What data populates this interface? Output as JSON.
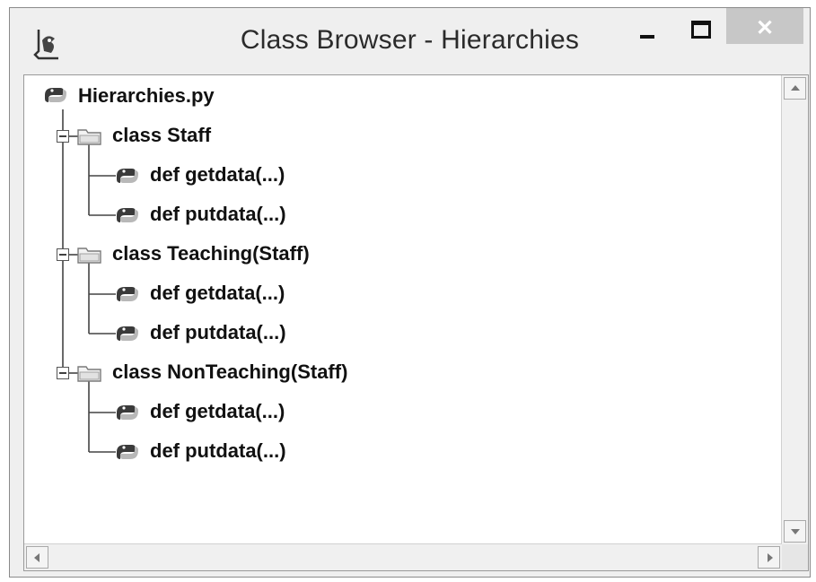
{
  "window": {
    "title": "Class Browser - Hierarchies",
    "close_glyph": "✕"
  },
  "tree": {
    "root": {
      "label": "Hierarchies.py",
      "icon": "python-file-icon"
    },
    "classes": [
      {
        "label": "class Staff",
        "expanded": true,
        "methods": [
          {
            "label": "def getdata(...)"
          },
          {
            "label": "def putdata(...)"
          }
        ]
      },
      {
        "label": "class Teaching(Staff)",
        "expanded": true,
        "methods": [
          {
            "label": "def getdata(...)"
          },
          {
            "label": "def putdata(...)"
          }
        ]
      },
      {
        "label": "class NonTeaching(Staff)",
        "expanded": true,
        "methods": [
          {
            "label": "def getdata(...)"
          },
          {
            "label": "def putdata(...)"
          }
        ]
      }
    ]
  },
  "colors": {
    "window_bg": "#efefef",
    "client_bg": "#ffffff",
    "text": "#111111",
    "close_button": "#c7c7c7"
  }
}
